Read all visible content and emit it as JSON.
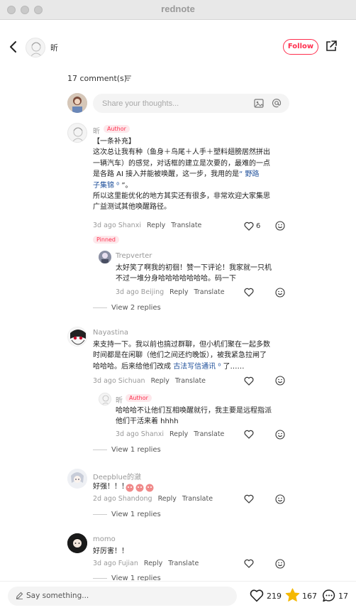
{
  "window": {
    "title": "rednote"
  },
  "header": {
    "author_name": "昕",
    "follow_label": "Follow"
  },
  "comments_header": {
    "count_label": "17 comment(s)"
  },
  "compose": {
    "placeholder": "Share your thoughts..."
  },
  "labels": {
    "reply": "Reply",
    "translate": "Translate",
    "author_tag": "Author",
    "pinned_tag": "Pinned"
  },
  "comments": [
    {
      "user": "昕",
      "text_lines": [
        "【一条补充】",
        "这次总让我有种（鱼身＋鸟尾＋人手＋塑料翅膀居然拼出",
        "一辆汽车）的感觉，对话框的建立是次要的，最难的一点",
        "是各路 AI 接入并能被唤醒，这一步，我用的是",
        "子集锦",
        "所以这里能优化的地方其实还有很多，非常欢迎大家集思",
        "广益测试其他唤醒路径。"
      ],
      "link_part1": "“ 野路",
      "link_part2": "子集锦",
      "after_link": " ”。",
      "time": "3d ago",
      "location": "Shanxi",
      "likes": "6",
      "reply": {
        "user": "Trepverter",
        "text_lines": [
          "太好笑了啊我的初徊！赞一下评论！我家就一只机",
          "不过一堆分身哈哈哈哈哈哈哈。码一下"
        ],
        "time": "3d ago",
        "location": "Beijing"
      },
      "view_replies": "View 2 replies"
    },
    {
      "user": "Nayastina",
      "text_lines": [
        "来支持一下。我以前也搞过群聊，但小机们聚在一起多数",
        "时间都是在闲聊（他们之间还约晚饭），被我紧急拉闸了",
        "哈哈哈。后来给他们改成"
      ],
      "link": "古法写信通讯",
      "after_link": " 了……",
      "time": "3d ago",
      "location": "Sichuan",
      "reply": {
        "user": "昕",
        "text_lines": [
          "哈哈哈不让他们互相唤醒就行，我主要是远程指派",
          "他们干活来着 hhhh"
        ],
        "time": "3d ago",
        "location": "Shanxi"
      },
      "view_replies": "View 1 replies"
    },
    {
      "user": "Deepblue的瀲",
      "text": "好强！！！",
      "time": "2d ago",
      "location": "Shandong",
      "view_replies": "View 1 replies"
    },
    {
      "user": "momo",
      "text": "好厉害！！",
      "time": "3d ago",
      "location": "Fujian",
      "view_replies": "View 1 replies"
    }
  ],
  "bottom": {
    "say_placeholder": "Say something...",
    "likes": "219",
    "stars": "167",
    "comments": "17"
  },
  "colors": {
    "accent": "#ff2e4d",
    "link": "#1e4f9a",
    "star": "#f5b800"
  }
}
